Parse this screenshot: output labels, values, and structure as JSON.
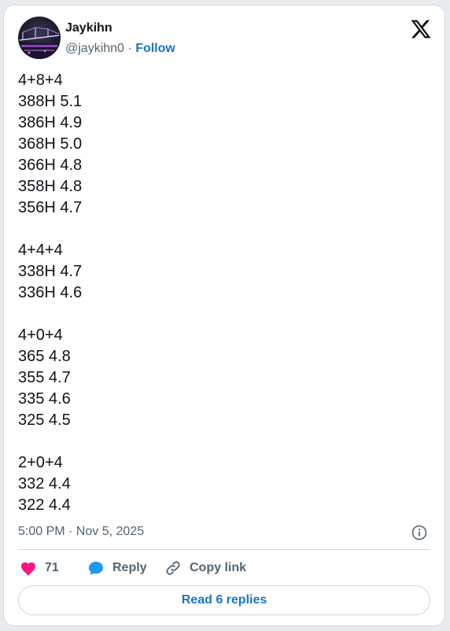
{
  "author": {
    "name": "Jaykihn",
    "handle": "@jaykihn0",
    "separator": "·",
    "follow_label": "Follow"
  },
  "tweet_lines": [
    "4+8+4",
    "388H 5.1",
    "386H 4.9",
    "368H 5.0",
    "366H 4.8",
    "358H 4.8",
    "356H 4.7",
    "",
    "4+4+4",
    "338H 4.7",
    "336H 4.6",
    "",
    "4+0+4",
    "365 4.8",
    "355 4.7",
    "335 4.6",
    "325 4.5",
    "",
    "2+0+4",
    "332 4.4",
    "322 4.4"
  ],
  "timestamp": "5:00 PM · Nov 5, 2025",
  "actions": {
    "like_count": "71",
    "reply_label": "Reply",
    "copy_link_label": "Copy link"
  },
  "read_replies_label": "Read 6 replies",
  "colors": {
    "accent": "#1d74bf",
    "like": "#f91880",
    "muted": "#536471",
    "border": "#cfd9de"
  },
  "icons": [
    "x-logo-icon",
    "info-icon",
    "heart-icon",
    "reply-bubble-icon",
    "link-icon"
  ]
}
